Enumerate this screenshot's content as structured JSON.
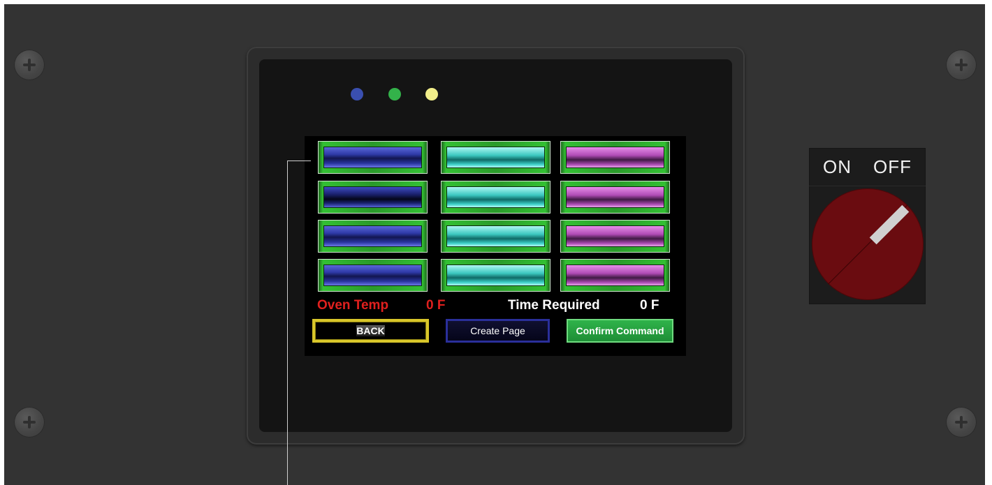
{
  "screen": {
    "readouts": {
      "oven_temp_label": "Oven Temp",
      "oven_temp_value": "0 F",
      "time_required_label": "Time Required",
      "time_required_value": "0 F"
    },
    "buttons": {
      "back_label": "BACK",
      "create_label": "Create Page",
      "confirm_label": "Confirm Command"
    },
    "grid": {
      "rows": 4,
      "columns": [
        {
          "color": "blue"
        },
        {
          "color": "cyan"
        },
        {
          "color": "magenta"
        }
      ]
    }
  },
  "leds": [
    {
      "name": "blue",
      "color": "#3a4fb0"
    },
    {
      "name": "green",
      "color": "#33b24a"
    },
    {
      "name": "yellow",
      "color": "#f2ee8a"
    }
  ],
  "switch": {
    "on_label": "ON",
    "off_label": "OFF",
    "knob_color": "#6a0c10"
  },
  "colors": {
    "panel": "#333333",
    "oven_temp": "#e0201e",
    "time_required": "#ffffff"
  }
}
